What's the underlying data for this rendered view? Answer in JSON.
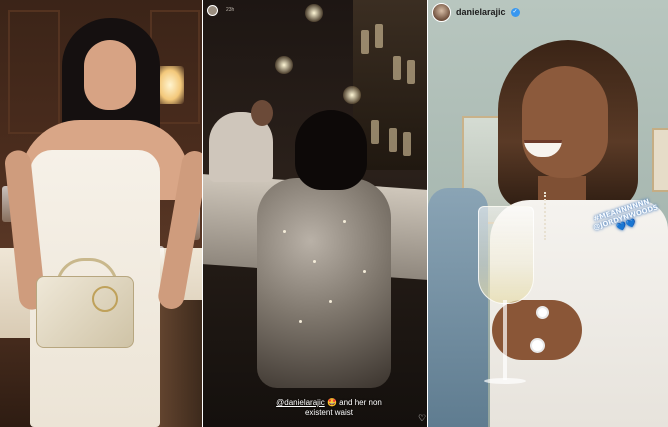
{
  "panels": {
    "middle": {
      "story_user": "",
      "story_time": "23h",
      "caption_mention": "@danielarajic",
      "caption_emoji": "🤩",
      "caption_text": "and her non existent waist"
    },
    "right": {
      "username": "danielarajic",
      "verified_mark": "✓",
      "sticker_text": "#MEANNNNNN @JORDYNWOODS",
      "sticker_hearts": "💙💙"
    }
  },
  "icons": {
    "heart": "♡"
  },
  "colors": {
    "verified_badge": "#3897f0",
    "sticker_glow": "#5aa6ff"
  }
}
